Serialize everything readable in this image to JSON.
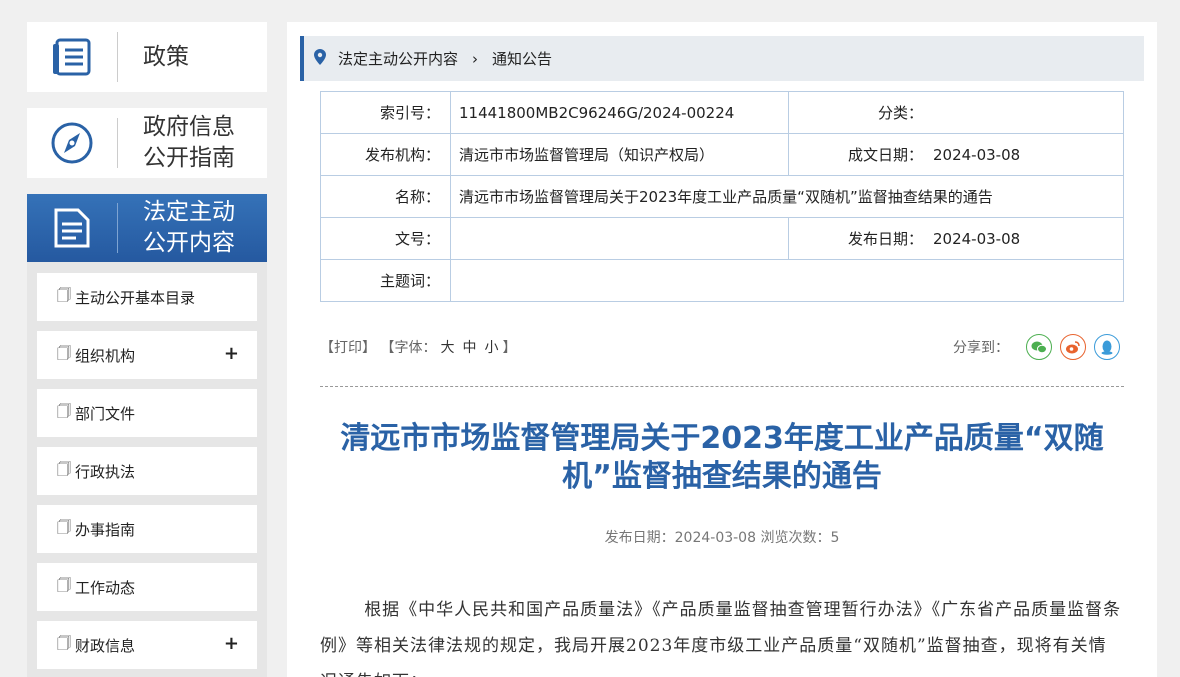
{
  "sidebar": {
    "policy": "政策",
    "guide": "政府信息\n公开指南",
    "legal": "法定主动\n公开内容",
    "items": [
      {
        "label": "主动公开基本目录",
        "expand": ""
      },
      {
        "label": "组织机构",
        "expand": "+"
      },
      {
        "label": "部门文件",
        "expand": ""
      },
      {
        "label": "行政执法",
        "expand": ""
      },
      {
        "label": "办事指南",
        "expand": ""
      },
      {
        "label": "工作动态",
        "expand": ""
      },
      {
        "label": "财政信息",
        "expand": "+"
      }
    ]
  },
  "breadcrumb": {
    "level1": "法定主动公开内容",
    "level2": "通知公告"
  },
  "meta": {
    "index_label": "索引号：",
    "index_value": "11441800MB2C96246G/2024-00224",
    "category_label": "分类：",
    "category_value": "",
    "publisher_label": "发布机构：",
    "publisher_value": "清远市市场监督管理局（知识产权局）",
    "created_label": "成文日期：",
    "created_value": "2024-03-08",
    "name_label": "名称：",
    "name_value": "清远市市场监督管理局关于2023年度工业产品质量“双随机”监督抽查结果的通告",
    "docno_label": "文号：",
    "docno_value": "",
    "pubdate_label": "发布日期：",
    "pubdate_value": "2024-03-08",
    "keywords_label": "主题词：",
    "keywords_value": ""
  },
  "toolbar": {
    "print": "【打印】",
    "font_prefix": "【字体：",
    "large": "大",
    "medium": "中",
    "small": "小",
    "font_suffix": "】",
    "share": "分享到："
  },
  "article": {
    "title": "清远市市场监督管理局关于2023年度工业产品质量“双随机”监督抽查结果的通告",
    "info": "发布日期：2024-03-08  浏览次数：5",
    "paragraph": "根据《中华人民共和国产品质量法》《产品质量监督抽查管理暂行办法》《广东省产品质量监督条例》等相关法律法规的规定，我局开展2023年度市级工业产品质量“双随机”监督抽查，现将有关情况通告如下："
  },
  "colors": {
    "accent": "#2a62a6",
    "wechat": "#4caf50",
    "weibo": "#e8632e",
    "qq": "#3a9bd9"
  }
}
